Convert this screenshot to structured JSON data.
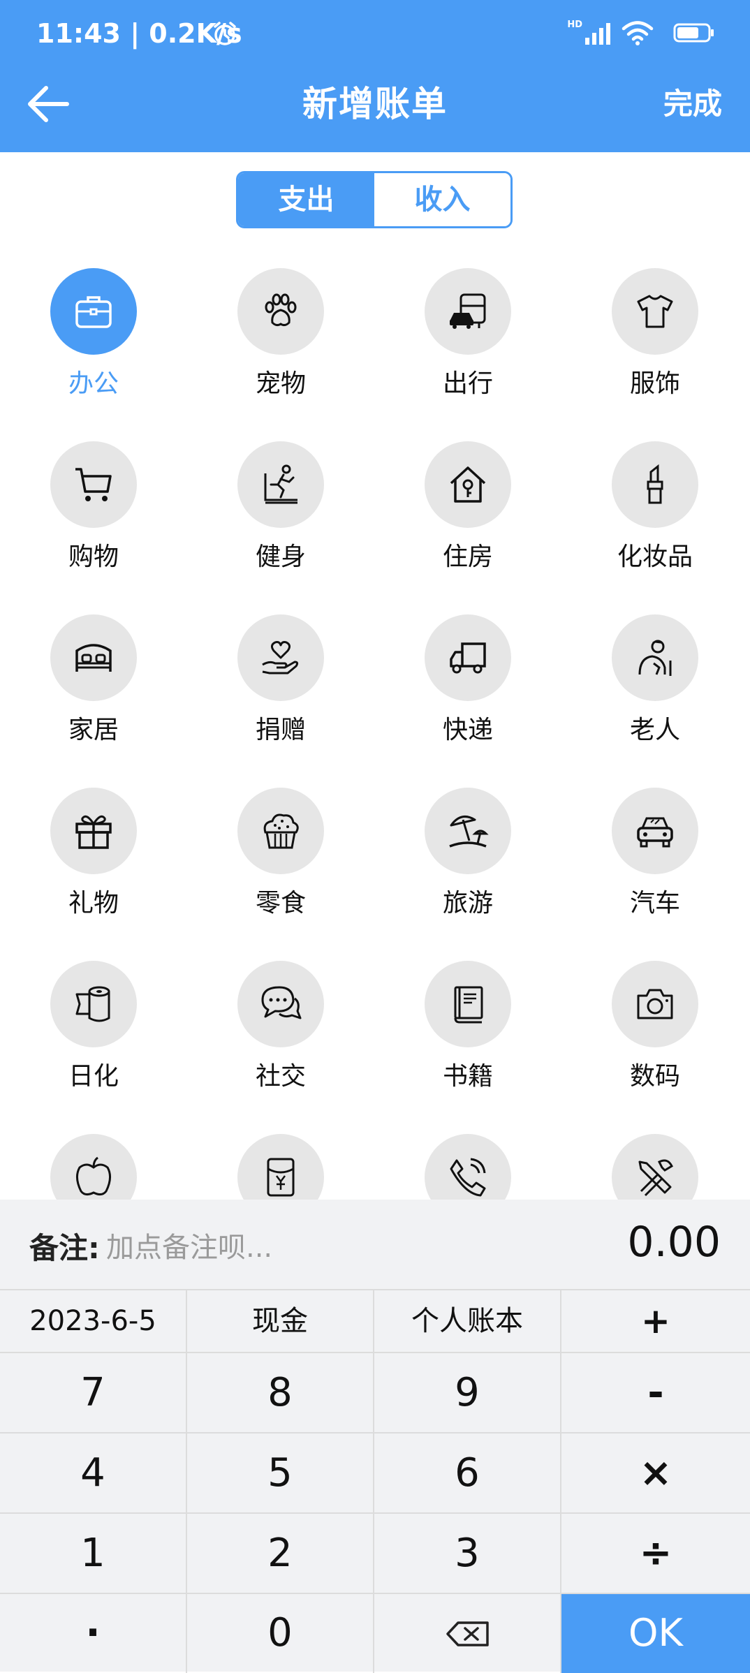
{
  "status_bar": {
    "time": "11:43 | 0.2K/s",
    "network": "HD",
    "battery": "70"
  },
  "header": {
    "title": "新增账单",
    "done_label": "完成"
  },
  "toggle": {
    "expense": "支出",
    "income": "收入"
  },
  "categories": [
    {
      "label": "办公",
      "icon": "briefcase-icon",
      "selected": true
    },
    {
      "label": "宠物",
      "icon": "paw-icon"
    },
    {
      "label": "出行",
      "icon": "bus-car-icon"
    },
    {
      "label": "服饰",
      "icon": "tshirt-icon"
    },
    {
      "label": "购物",
      "icon": "cart-icon"
    },
    {
      "label": "健身",
      "icon": "treadmill-icon"
    },
    {
      "label": "住房",
      "icon": "house-key-icon"
    },
    {
      "label": "化妆品",
      "icon": "lipstick-icon"
    },
    {
      "label": "家居",
      "icon": "bed-icon"
    },
    {
      "label": "捐赠",
      "icon": "heart-hand-icon"
    },
    {
      "label": "快递",
      "icon": "truck-icon"
    },
    {
      "label": "老人",
      "icon": "elder-icon"
    },
    {
      "label": "礼物",
      "icon": "gift-icon"
    },
    {
      "label": "零食",
      "icon": "cupcake-icon"
    },
    {
      "label": "旅游",
      "icon": "beach-icon"
    },
    {
      "label": "汽车",
      "icon": "car-icon"
    },
    {
      "label": "日化",
      "icon": "tissue-roll-icon"
    },
    {
      "label": "社交",
      "icon": "chat-icon"
    },
    {
      "label": "书籍",
      "icon": "book-icon"
    },
    {
      "label": "数码",
      "icon": "camera-icon"
    },
    {
      "label": "",
      "icon": "apple-icon"
    },
    {
      "label": "",
      "icon": "red-envelope-icon"
    },
    {
      "label": "",
      "icon": "phone-icon"
    },
    {
      "label": "",
      "icon": "tools-icon"
    }
  ],
  "note": {
    "label": "备注:",
    "placeholder": "加点备注呗...",
    "amount": "0.00"
  },
  "keypad": {
    "date": "2023-6-5",
    "account": "现金",
    "ledger": "个人账本",
    "plus": "+",
    "minus": "-",
    "times": "×",
    "divide": "÷",
    "digits": [
      "7",
      "8",
      "9",
      "4",
      "5",
      "6",
      "1",
      "2",
      "3"
    ],
    "dot": "·",
    "zero": "0",
    "ok": "OK"
  },
  "colors": {
    "accent": "#4a9cf5",
    "icon_bg": "#e6e6e6",
    "panel_bg": "#f1f2f4"
  }
}
